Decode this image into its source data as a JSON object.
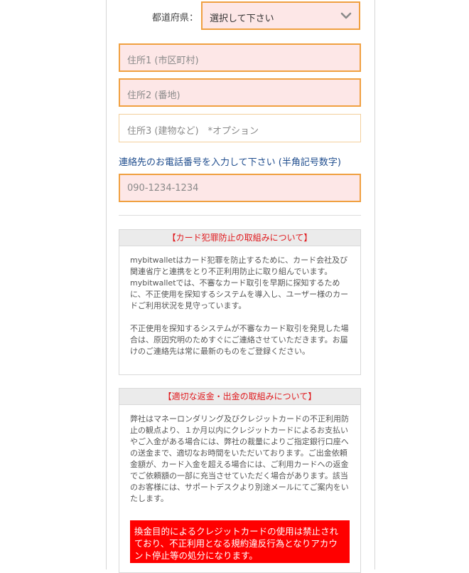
{
  "address": {
    "prefecture_label": "都道府県：",
    "prefecture_selected": "選択して下さい",
    "address1_placeholder": "住所1 (市区町村)",
    "address2_placeholder": "住所2 (番地)",
    "address3_placeholder": "住所3 (建物など)　*オプション"
  },
  "phone": {
    "label": "連絡先のお電話番号を入力して下さい (半角記号数字)",
    "placeholder": "090-1234-1234"
  },
  "fraud_notice": {
    "title": "【カード犯罪防止の取組みについて】",
    "paragraph1": "mybitwalletはカード犯罪を防止するために、カード会社及び関連省庁と連携をとり不正利用防止に取り組んでいます。mybitwalletでは、不審なカード取引を早期に探知するために、不正使用を探知するシステムを導入し、ユーザー様のカードご利用状況を見守っています。",
    "paragraph2": "不正使用を探知するシステムが不審なカード取引を発見した場合は、原因究明のためすぐにご連絡させていただきます。お届けのご連絡先は常に最新のものをご登録ください。"
  },
  "refund_notice": {
    "title": "【適切な返金・出金の取組みについて】",
    "paragraph1": "弊社はマネーロンダリング及びクレジットカードの不正利用防止の観点より、１か月以内にクレジットカードによるお支払いやご入金がある場合には、弊社の裁量によりご指定銀行口座への送金まで、適切なお時間をいただいております。ご出金依頼金額が、カード入金を超える場合には、ご利用カードへの返金でご依頼額の一部に充当させていただく場合があります。該当のお客様には、サポートデスクより別途メールにてご案内をいたします。",
    "warning": "換金目的によるクレジットカードの使用は禁止されており、不正利用となる規約違反行為となりアカウント停止等の処分になります。"
  },
  "colors": {
    "required_bg": "#fde7e7",
    "required_border": "#f0a040",
    "notice_title": "#e0191d",
    "link_blue": "#1f4d8e",
    "alert_bg": "#ff0000"
  }
}
